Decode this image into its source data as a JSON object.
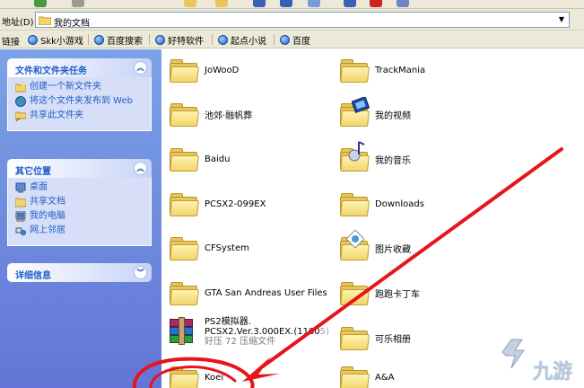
{
  "address_bar": {
    "label": "地址(D)",
    "value": "我的文档"
  },
  "links_bar": {
    "label": "链接",
    "links": [
      "Skk小游戏",
      "百度搜索",
      "好特软件",
      "起点小说",
      "百度"
    ]
  },
  "task_pane": {
    "file_tasks": {
      "title": "文件和文件夹任务",
      "items": [
        "创建一个新文件夹",
        "将这个文件夹发布到 Web",
        "共享此文件夹"
      ]
    },
    "other_places": {
      "title": "其它位置",
      "items": [
        "桌面",
        "共享文档",
        "我的电脑",
        "网上邻居"
      ]
    },
    "details": {
      "title": "详细信息"
    }
  },
  "files": [
    {
      "name": "JoWooD"
    },
    {
      "name": "TrackMania"
    },
    {
      "name": "池郊·融帆葬"
    },
    {
      "name": "我的视频"
    },
    {
      "name": "Baidu"
    },
    {
      "name": "我的音乐"
    },
    {
      "name": "PCSX2-099EX"
    },
    {
      "name": "Downloads"
    },
    {
      "name": "CFSystem"
    },
    {
      "name": "图片收藏"
    },
    {
      "name": "GTA San Andreas User Files"
    },
    {
      "name": "跑跑卡丁车"
    },
    {
      "name": "PS2模拟器.",
      "line2": "PCSX2.Ver.3.000EX.(1100",
      "line2_tail": "5)",
      "line3": "好压 72 压缩文件"
    },
    {
      "name": "可乐相册"
    },
    {
      "name": "Koei"
    },
    {
      "name": "A&A"
    }
  ],
  "watermark": {
    "text": "九游"
  },
  "colors": {
    "task_pane_gradient_top": "#7ba2e7",
    "task_pane_gradient_bottom": "#6375d6",
    "panel_title": "#215dc6",
    "annotation_red": "#e8141a"
  }
}
